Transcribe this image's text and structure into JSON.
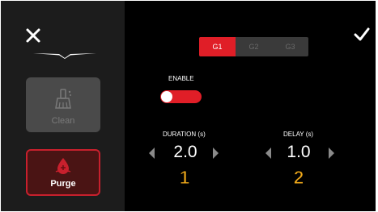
{
  "colors": {
    "accent": "#e01e27",
    "sidebar_bg": "#1c1c1c",
    "panel_bg": "#000000",
    "badge": "#f0a91a"
  },
  "header": {
    "close_icon": "close-icon",
    "confirm_icon": "check-icon"
  },
  "sidebar": {
    "tiles": [
      {
        "label": "Clean",
        "icon": "brush-icon",
        "state": "disabled"
      },
      {
        "label": "Purge",
        "icon": "purge-drop-icon",
        "state": "selected"
      }
    ]
  },
  "groups": {
    "tabs": [
      {
        "label": "G1",
        "active": true
      },
      {
        "label": "G2",
        "active": false
      },
      {
        "label": "G3",
        "active": false
      }
    ]
  },
  "enable": {
    "label": "ENABLE",
    "on": true
  },
  "duration": {
    "label": "DURATION (s)",
    "value": "2.0",
    "badge": "1"
  },
  "delay": {
    "label": "DELAY (s)",
    "value": "1.0",
    "badge": "2"
  }
}
